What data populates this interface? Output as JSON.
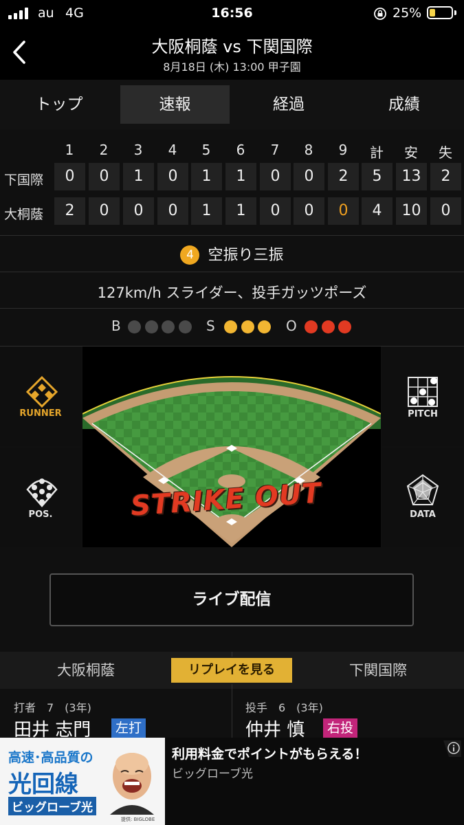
{
  "status_bar": {
    "carrier": "au",
    "network": "4G",
    "time": "16:56",
    "battery": "25%",
    "battery_level": 0.25,
    "icons": [
      "signal-icon",
      "rotation-lock-icon",
      "battery-icon"
    ]
  },
  "header": {
    "title": "大阪桐蔭 vs 下関国際",
    "subtitle": "8月18日 (木) 13:00 甲子園",
    "back_icon": "chevron-left-icon"
  },
  "tabs": [
    {
      "label": "トップ",
      "active": false
    },
    {
      "label": "速報",
      "active": true
    },
    {
      "label": "経過",
      "active": false
    },
    {
      "label": "成績",
      "active": false
    }
  ],
  "scoreboard": {
    "columns": [
      "1",
      "2",
      "3",
      "4",
      "5",
      "6",
      "7",
      "8",
      "9",
      "計",
      "安",
      "失"
    ],
    "rows": [
      {
        "team": "下国際",
        "cells": [
          "0",
          "0",
          "1",
          "0",
          "1",
          "1",
          "0",
          "0",
          "2",
          "5",
          "13",
          "2"
        ]
      },
      {
        "team": "大桐蔭",
        "cells": [
          "2",
          "0",
          "0",
          "0",
          "1",
          "1",
          "0",
          "0",
          "0",
          "4",
          "10",
          "0"
        ]
      }
    ],
    "pending_color": "#f0a020"
  },
  "play": {
    "badge": "4",
    "title": "空振り三振",
    "description": "127km/h スライダー、投手ガッツポーズ"
  },
  "count": {
    "balls_label": "B",
    "balls": 0,
    "balls_max": 4,
    "strikes_label": "S",
    "strikes": 3,
    "strikes_max": 3,
    "outs_label": "O",
    "outs": 3,
    "outs_max": 3,
    "colors": {
      "ball_off": "#4a4a4a",
      "strike_on": "#f2b632",
      "out_on": "#e23a22"
    }
  },
  "field": {
    "overlay_text": "STRIKE OUT",
    "buttons": [
      {
        "label": "RUNNER",
        "icon": "runner-diamond-icon",
        "active": true
      },
      {
        "label": "POS.",
        "icon": "positions-icon",
        "active": false
      },
      {
        "label": "PITCH",
        "icon": "pitch-grid-icon",
        "active": false
      },
      {
        "label": "DATA",
        "icon": "radar-chart-icon",
        "active": false
      }
    ]
  },
  "live_button": "ライブ配信",
  "team_tabs": {
    "left": "大阪桐蔭",
    "replay": "リプレイを見る",
    "right": "下関国際"
  },
  "batter": {
    "role": "打者　7　(3年)",
    "name": "田井 志門",
    "hand": "左打",
    "hand_color": "#2f6fc7"
  },
  "pitcher": {
    "role": "投手　6　(3年)",
    "name": "仲井 慎",
    "hand": "右投",
    "hand_color": "#c2257a"
  },
  "ad": {
    "image_lines": [
      "高速･高品質の",
      "光回線",
      "ビッグローブ光"
    ],
    "image_caption": "提供: BIGLOBE",
    "headline": "利用料金でポイントがもらえる！",
    "subtext": "ビッグローブ光",
    "info_icon": "info-icon"
  }
}
